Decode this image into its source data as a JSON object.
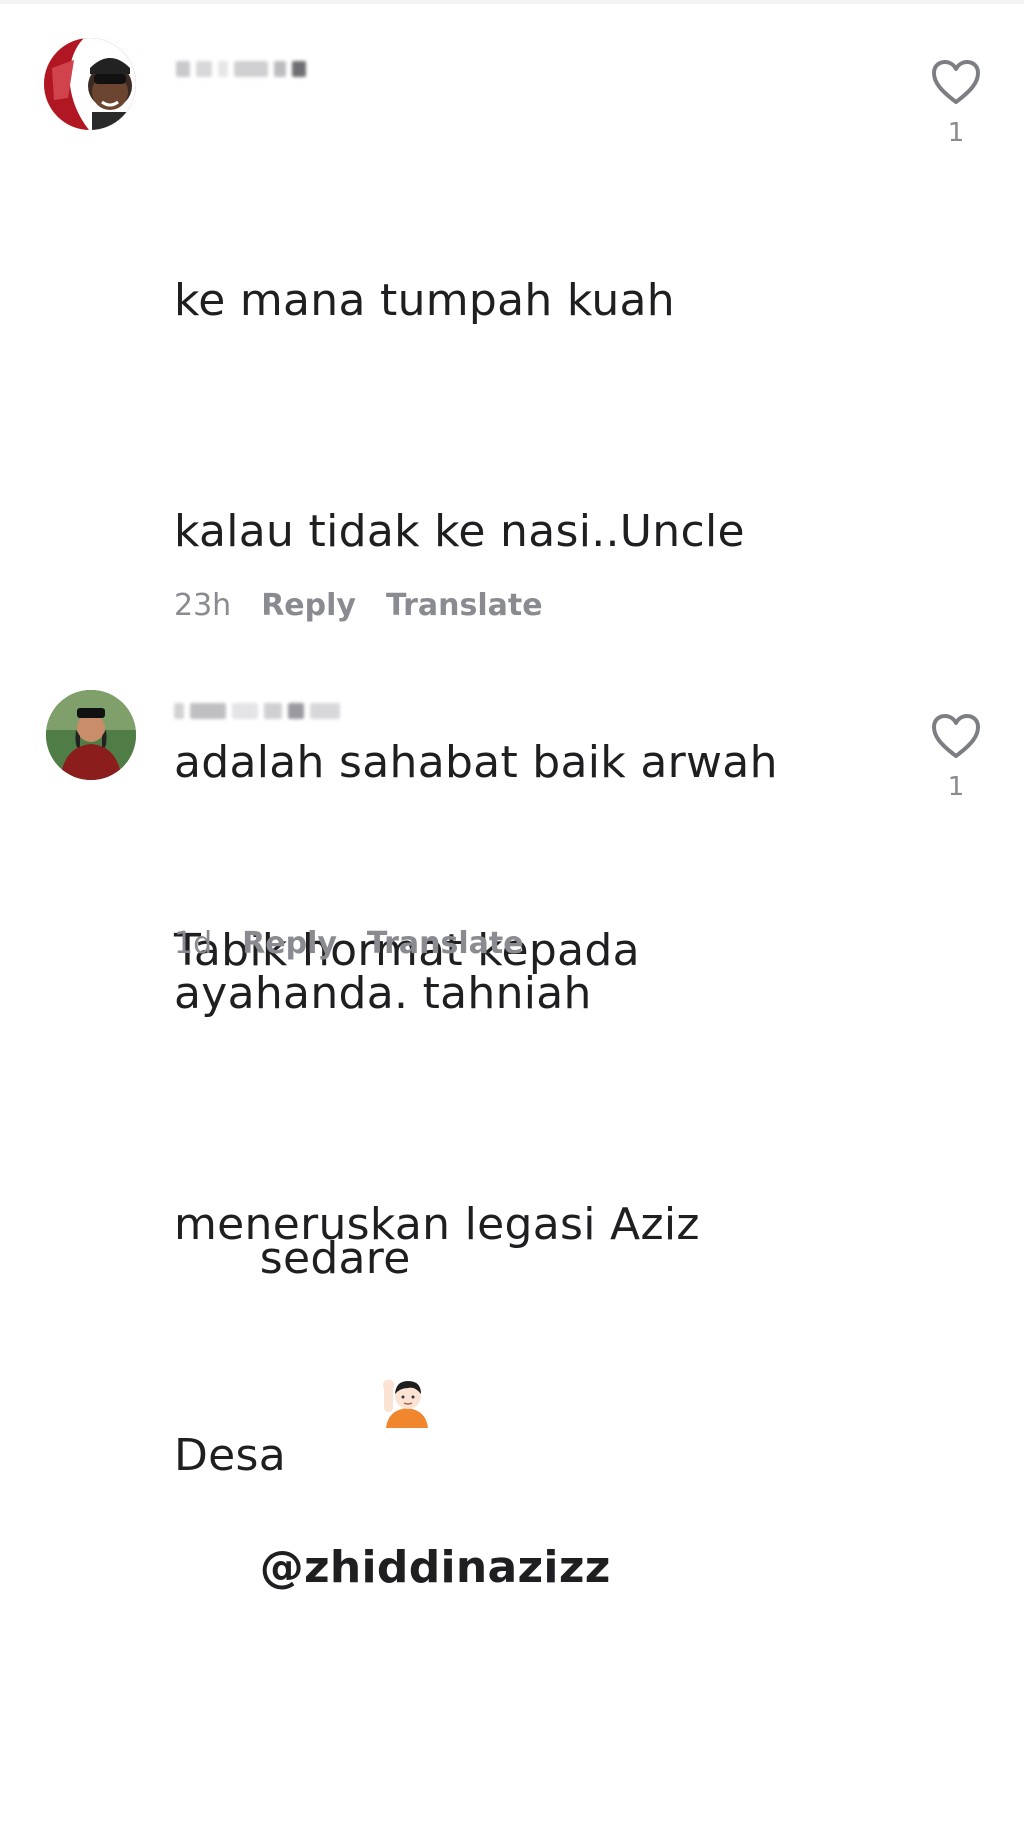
{
  "comments": [
    {
      "text_lines": [
        "ke mana tumpah kuah",
        "kalau tidak ke nasi..Uncle",
        "adalah sahabat baik arwah",
        "ayahanda. tahniah",
        "meneruskan legasi Aziz",
        "Desa"
      ],
      "time": "23h",
      "reply_label": "Reply",
      "translate_label": "Translate",
      "like_count": "1",
      "like_icon": "heart-outline-icon"
    },
    {
      "text_line1": "Tabik hormat kepada",
      "text_line2_prefix": "sedare",
      "emoji": "person-raising-hand-emoji",
      "mention": "@zhiddinazizz",
      "time": "1d",
      "reply_label": "Reply",
      "translate_label": "Translate",
      "like_count": "1",
      "like_icon": "heart-outline-icon"
    }
  ],
  "colors": {
    "text": "#1f1f22",
    "meta": "#8a8b91",
    "background": "#ffffff"
  }
}
